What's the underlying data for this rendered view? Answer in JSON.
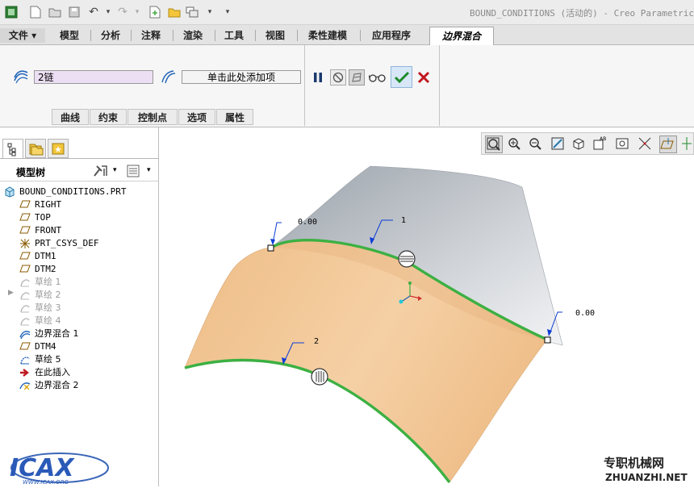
{
  "window_title": "BOUND_CONDITIONS (活动的) - Creo Parametric",
  "ribbon": {
    "tabs": [
      "文件 ▾",
      "模型",
      "分析",
      "注释",
      "渲染",
      "工具",
      "视图",
      "柔性建模",
      "应用程序"
    ],
    "active_tab": "边界混合"
  },
  "dashboard": {
    "first_direction_value": "2链",
    "second_direction_placeholder": "单击此处添加项",
    "subtabs": [
      "曲线",
      "约束",
      "控制点",
      "选项",
      "属性"
    ]
  },
  "model_tree": {
    "title": "模型树",
    "root": "BOUND_CONDITIONS.PRT",
    "items": [
      {
        "label": "RIGHT",
        "type": "plane"
      },
      {
        "label": "TOP",
        "type": "plane"
      },
      {
        "label": "FRONT",
        "type": "plane"
      },
      {
        "label": "PRT_CSYS_DEF",
        "type": "csys"
      },
      {
        "label": "DTM1",
        "type": "plane"
      },
      {
        "label": "DTM2",
        "type": "plane"
      },
      {
        "label": "草绘 1",
        "type": "sketch-faded"
      },
      {
        "label": "草绘 2",
        "type": "sketch-faded"
      },
      {
        "label": "草绘 3",
        "type": "sketch-faded"
      },
      {
        "label": "草绘 4",
        "type": "sketch-faded"
      },
      {
        "label": "边界混合 1",
        "type": "blend"
      },
      {
        "label": "DTM4",
        "type": "plane"
      },
      {
        "label": "草绘 5",
        "type": "sketch"
      },
      {
        "label": "在此插入",
        "type": "insert"
      },
      {
        "label": "边界混合 2",
        "type": "blend-new"
      }
    ]
  },
  "viewport": {
    "annotations": [
      "0.00",
      "1",
      "0.00",
      "2"
    ]
  },
  "watermarks": {
    "logo_text": "ICAX",
    "logo_url": "WWW.ICAX.ORG",
    "site_cn": "专职机械网",
    "site_en": "ZHUANZHI.NET"
  },
  "colors": {
    "surface": "#f5cfa0",
    "curve": "#3cb043",
    "gray_surface": "#9aa0a6",
    "accent_blue": "#0b3cd6"
  }
}
